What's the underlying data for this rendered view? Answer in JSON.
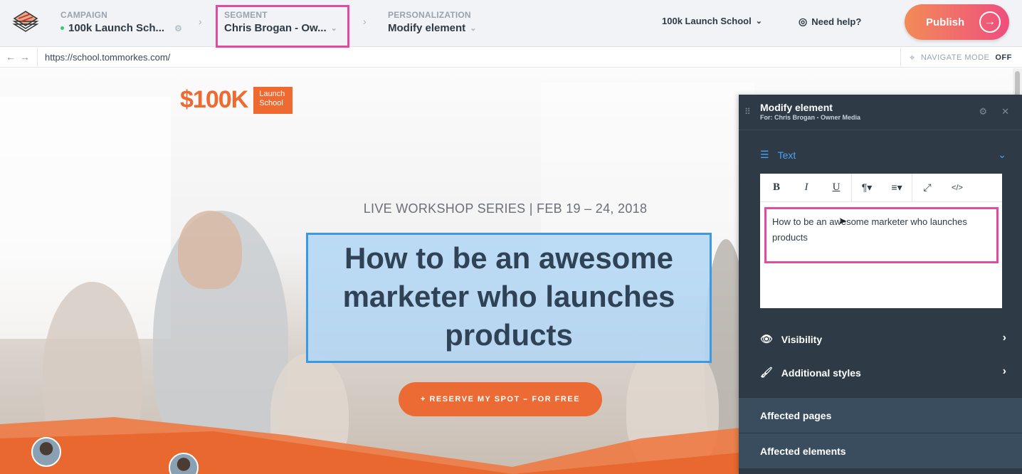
{
  "topbar": {
    "campaign": {
      "label": "CAMPAIGN",
      "value": "100k Launch Sch..."
    },
    "segment": {
      "label": "SEGMENT",
      "value": "Chris Brogan - Ow..."
    },
    "personalization": {
      "label": "PERSONALIZATION",
      "value": "Modify element"
    },
    "site_selector": "100k Launch School",
    "help": "Need help?",
    "publish": "Publish",
    "colors": {
      "publish_from": "#f28b58",
      "publish_to": "#ee4f7e",
      "highlight": "#e24ba0"
    }
  },
  "urlbar": {
    "url": "https://school.tommorkes.com/",
    "navigate_mode_label": "NAVIGATE MODE",
    "navigate_mode_state": "OFF"
  },
  "page": {
    "brand_text": "$100K",
    "brand_tag_line1": "Launch",
    "brand_tag_line2": "School",
    "eyebrow": "LIVE WORKSHOP SERIES | FEB 19 – 24, 2018",
    "headline": "How to be an awesome marketer who launches products",
    "cta": "+ RESERVE MY SPOT – FOR FREE",
    "accent_color": "#ec6a33"
  },
  "panel": {
    "title": "Modify element",
    "subtitle": "For: Chris Brogan - Owner Media",
    "text_section": "Text",
    "editor_toolbar": {
      "bold": "B",
      "italic": "I",
      "underline": "U",
      "paragraph": "¶",
      "align": "≡",
      "expand": "⤢",
      "code": "</>"
    },
    "editor_content": "How to be an awesome marketer who launches products",
    "visibility": "Visibility",
    "additional_styles": "Additional styles",
    "affected_pages": "Affected pages",
    "affected_elements": "Affected elements"
  }
}
